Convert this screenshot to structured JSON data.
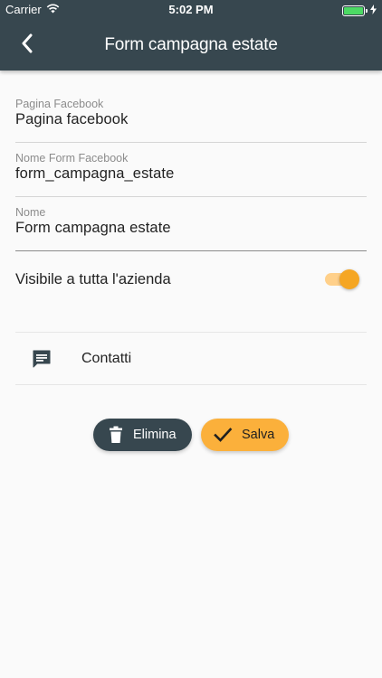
{
  "status_bar": {
    "carrier": "Carrier",
    "time": "5:02 PM",
    "battery_level": 1.0
  },
  "header": {
    "title": "Form campagna estate",
    "back_icon": "chevron-left-icon",
    "background": "#37474f"
  },
  "form": {
    "fields": [
      {
        "label": "Pagina Facebook",
        "value": "Pagina facebook"
      },
      {
        "label": "Nome Form Facebook",
        "value": "form_campagna_estate"
      },
      {
        "label": "Nome",
        "value": "Form campagna estate"
      }
    ],
    "visibility": {
      "label": "Visibile a tutta l'azienda",
      "enabled": true
    }
  },
  "contacts": {
    "label": "Contatti",
    "icon": "message-icon"
  },
  "actions": {
    "delete_label": "Elimina",
    "delete_icon": "trash-icon",
    "save_label": "Salva",
    "save_icon": "check-icon"
  },
  "colors": {
    "primary": "#37474f",
    "accent": "#fbb03b",
    "switch_thumb": "#f5a623",
    "switch_track": "#ffd08a",
    "battery": "#4cd964"
  }
}
